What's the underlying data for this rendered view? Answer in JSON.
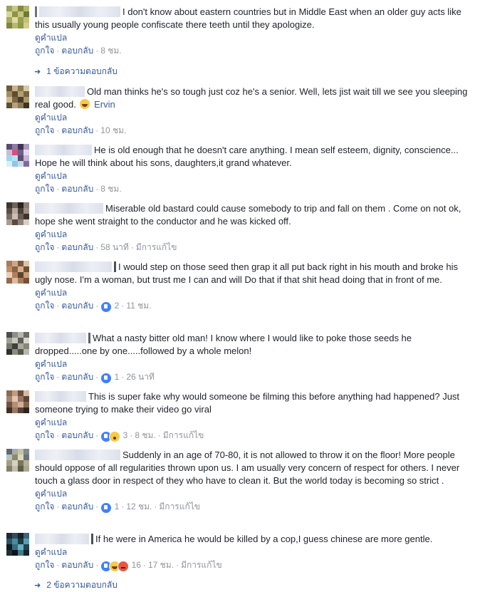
{
  "labels": {
    "translate": "ดูคำแปล",
    "like": "ถูกใจ",
    "reply": "ตอบกลับ",
    "edited": "มีการแก้ไข",
    "sep": "·"
  },
  "comments": [
    {
      "text": "I don't know about eastern countries but in Middle East when an older guy acts like this usually young people confiscate there teeth until they apologize.",
      "time": "8 ชม.",
      "reactions": "",
      "edited": false,
      "replies": "1 ข้อความตอบกลับ"
    },
    {
      "text": "Old man thinks he's so tough just coz he's a senior. Well, lets jist wait till we see you sleeping real good.",
      "mention": "Ervin",
      "time": "10 ชม.",
      "reactions": "",
      "edited": false
    },
    {
      "text": "He is old enough that he doesn't care anything. I mean self esteem, dignity, conscience... Hope he will think about his sons, daughters,it grand whatever.",
      "time": "8 ชม.",
      "reactions": "",
      "edited": false
    },
    {
      "text": "Miserable old bastard could cause somebody to trip and fall on them . Come on not ok, hope she went straight to the conductor and he was kicked off.",
      "time": "58 นาที",
      "reactions": "",
      "edited": true
    },
    {
      "text": "I would step on those seed then grap it all put back right in his mouth and broke his ugly nose. I'm a woman, but trust me I can and will Do that if that shit head doing that in front of me.",
      "time": "11 ชม.",
      "reactions": "2",
      "edited": false
    },
    {
      "text": "What a nasty bitter old man! I know where I would like to poke those seeds he dropped.....one by one.....followed by a whole melon!",
      "time": "26 นาที",
      "reactions": "1",
      "edited": false
    },
    {
      "text": "This is super fake why would someone be filming this before anything had happened? Just someone trying to make their video go viral",
      "time": "8 ชม.",
      "reactions": "3",
      "edited": true
    },
    {
      "text": "Suddenly in an age of 70-80, it is not allowed to throw it on the floor! More people should oppose of all regularities thrown upon us. I am usually very concern of respect for others. I never touch a glass door in respect of they who have to clean it. But the world today is becoming so strict .",
      "time": "12 ชม.",
      "reactions": "1",
      "edited": true
    },
    {
      "text": "If he were in America he would be killed by a cop,I guess chinese are more gentle.",
      "time": "17 ชม.",
      "reactions": "16",
      "edited": true
    }
  ],
  "footer_replies": "2 ข้อความตอบกลับ",
  "colors": {
    "link": "#365899",
    "meta": "#90949c",
    "text": "#1d2129",
    "like_blue": "#4080ff"
  }
}
